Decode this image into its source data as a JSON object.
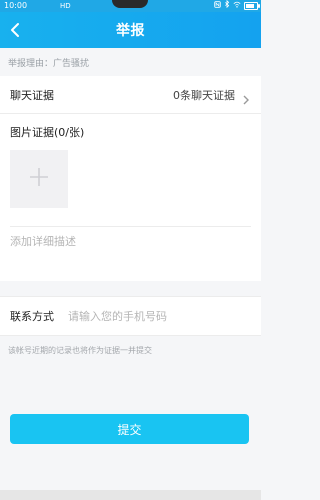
{
  "status_bar": {
    "time": "10:00",
    "network": "HD"
  },
  "header": {
    "title": "举报",
    "back_icon": "back-chevron-icon"
  },
  "reason": {
    "text": "举报理由：广告骚扰"
  },
  "chat_evidence": {
    "label": "聊天证据",
    "value": "0条聊天证据"
  },
  "image_evidence": {
    "label": "图片证据(0/张)",
    "add_icon": "plus-icon"
  },
  "description": {
    "placeholder": "添加详细描述"
  },
  "contact": {
    "label": "联系方式",
    "placeholder": "请输入您的手机号码"
  },
  "hint": {
    "text": "该帐号近期的记录也将作为证据一并提交"
  },
  "submit": {
    "label": "提交"
  },
  "colors": {
    "primary": "#1aa8ef",
    "submit": "#19c4f2"
  }
}
